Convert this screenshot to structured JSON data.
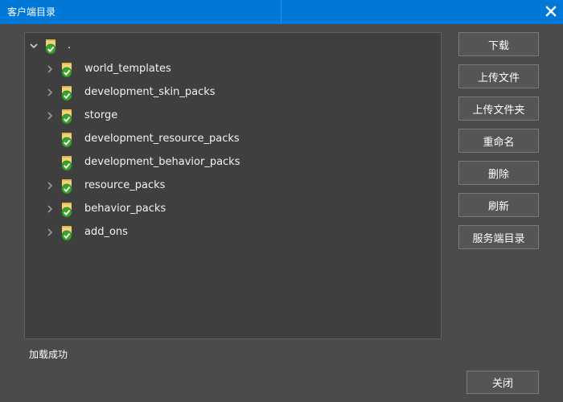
{
  "window": {
    "title": "客户端目录"
  },
  "tree": {
    "root": {
      "label": ".",
      "expanded": true,
      "icon": "folder-check-icon"
    },
    "items": [
      {
        "label": "world_templates",
        "expandable": true
      },
      {
        "label": "development_skin_packs",
        "expandable": true
      },
      {
        "label": "storge",
        "expandable": true
      },
      {
        "label": "development_resource_packs",
        "expandable": false
      },
      {
        "label": "development_behavior_packs",
        "expandable": false
      },
      {
        "label": "resource_packs",
        "expandable": true
      },
      {
        "label": "behavior_packs",
        "expandable": true
      },
      {
        "label": "add_ons",
        "expandable": true
      }
    ]
  },
  "buttons": {
    "download": "下载",
    "upload_file": "上传文件",
    "upload_folder": "上传文件夹",
    "rename": "重命名",
    "delete": "删除",
    "refresh": "刷新",
    "server_dir": "服务端目录",
    "close": "关闭"
  },
  "status": {
    "text": "加载成功"
  },
  "colors": {
    "titlebar": "#0078d7",
    "background": "#4b4b4b",
    "tree_bg": "#3f3f3f",
    "folder": "#f0d27a",
    "check": "#3aa52a"
  }
}
